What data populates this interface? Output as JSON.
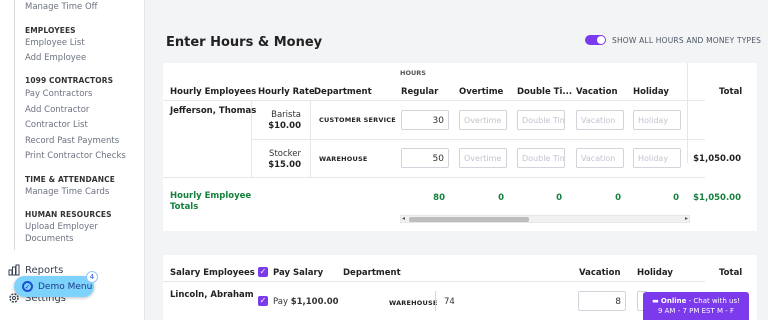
{
  "sidebar": {
    "top_link": "Manage Time Off",
    "sections": [
      {
        "title": "EMPLOYEES",
        "links": [
          "Employee List",
          "Add Employee"
        ]
      },
      {
        "title": "1099 CONTRACTORS",
        "links": [
          "Pay Contractors",
          "Add Contractor",
          "Contractor List",
          "Record Past Payments",
          "Print Contractor Checks"
        ]
      },
      {
        "title": "TIME & ATTENDANCE",
        "links": [
          "Manage Time Cards"
        ]
      },
      {
        "title": "HUMAN RESOURCES",
        "links": [
          "Upload Employer",
          "Documents"
        ]
      }
    ],
    "reports": "Reports",
    "settings": "Settings",
    "demo_menu": "Demo Menu",
    "demo_badge": "4"
  },
  "page": {
    "title": "Enter Hours & Money",
    "toggle_label": "SHOW ALL HOURS AND MONEY TYPES",
    "toggle_on": true
  },
  "hourly_table": {
    "hours_caption": "HOURS",
    "headers": {
      "employees": "Hourly Employees",
      "rate": "Hourly Rate",
      "department": "Department",
      "regular": "Regular",
      "overtime": "Overtime",
      "double": "Double Ti...",
      "vacation": "Vacation",
      "holiday": "Holiday",
      "total": "Total"
    },
    "employee_name": "Jefferson, Thomas",
    "rows": [
      {
        "role": "Barista",
        "rate": "$10.00",
        "department": "CUSTOMER SERVICE",
        "regular": "30",
        "overtime_ph": "Overtime",
        "double_ph": "Double Time",
        "vacation_ph": "Vacation",
        "holiday_ph": "Holiday",
        "total": ""
      },
      {
        "role": "Stocker",
        "rate": "$15.00",
        "department": "WAREHOUSE",
        "regular": "50",
        "overtime_ph": "Overtime",
        "double_ph": "Double Time",
        "vacation_ph": "Vacation",
        "holiday_ph": "Holiday",
        "total": "$1,050.00"
      }
    ],
    "totals": {
      "label_line1": "Hourly Employee",
      "label_line2": "Totals",
      "regular": "80",
      "overtime": "0",
      "double": "0",
      "vacation": "0",
      "holiday": "0",
      "total": "$1,050.00"
    },
    "scroll_left": "◂",
    "scroll_right": "▸"
  },
  "salary_table": {
    "headers": {
      "employees": "Salary Employees",
      "pay_salary": "Pay Salary",
      "department": "Department",
      "vacation": "Vacation",
      "holiday": "Holiday",
      "total": "Total"
    },
    "row": {
      "name": "Lincoln, Abraham",
      "pay_label": "Pay",
      "amount": "$1,100.00",
      "department": "WAREHOUSE",
      "hours": "74",
      "vacation": "8"
    }
  },
  "chat": {
    "status": "Online",
    "line1_rest": " - Chat with us!",
    "line2": "9 AM - 7 PM EST M - F"
  },
  "colors": {
    "accent": "#7c3aed",
    "green": "#15803d",
    "demo": "#7dd3fc"
  }
}
